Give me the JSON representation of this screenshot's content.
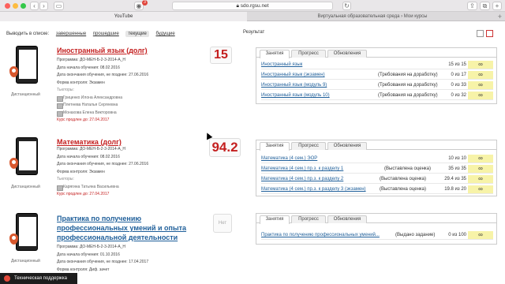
{
  "browser": {
    "url": "sdo.rgsu.net",
    "notification_count": "3",
    "tabs": [
      {
        "label": "YouTube",
        "active": true
      },
      {
        "label": "Виртуальная образовательная среда › Мои курсы",
        "active": false
      }
    ]
  },
  "filter": {
    "prefix": "Выводить в списке:",
    "options": [
      "завершенные",
      "прошедшие",
      "текущие",
      "будущие"
    ],
    "current": "текущие",
    "result_label": "Результат"
  },
  "courses": [
    {
      "title": "Иностранный язык (долг)",
      "program": "Программа: ДО-МЕН-Б-2-3-2014-А_Н",
      "start": "Дата начала обучения: 08.02.2016",
      "end": "Дата окончания обучения, не позднее: 27.06.2016",
      "control": "Форма контроля: Экзамен",
      "tutors_head": "Тьюторы:",
      "tutors": [
        "Гриценко Илона Александровна",
        "Плетнева Наталья Сергеевна",
        "Монахова Елена Викторовна"
      ],
      "extended": "Курс продлен до: 27.04.2017",
      "mode": "Дистанционный",
      "score": "15",
      "tabs": [
        "Занятия",
        "Прогресс",
        "Обновления"
      ],
      "rows": [
        {
          "name": "Иностранный язык",
          "status": "",
          "value": "15 из 15",
          "icon": "∞"
        },
        {
          "name": "Иностранный язык (экзамен)",
          "status": "(Требования на доработку)",
          "value": "0 из 17",
          "icon": "∞"
        },
        {
          "name": "Иностранный язык (модуль 9)",
          "status": "(Требования на доработку)",
          "value": "0 из 33",
          "icon": "∞"
        },
        {
          "name": "Иностранный язык (модуль 10)",
          "status": "(Требования на доработку)",
          "value": "0 из 32",
          "icon": "∞"
        }
      ]
    },
    {
      "title": "Математика (долг)",
      "program": "Программа: ДО-МЕН-Б-2-3-2014-А_Н",
      "start": "Дата начала обучения: 08.02.2016",
      "end": "Дата окончания обучения, не позднее: 27.06.2016",
      "control": "Форма контроля: Экзамен",
      "tutors_head": "Тьюторы:",
      "tutors": [
        "Карягина Татьяна Васильевна"
      ],
      "extended": "Курс продлен до: 27.04.2017",
      "mode": "Дистанционный",
      "score": "94.2",
      "tabs": [
        "Занятия",
        "Прогресс",
        "Обновления"
      ],
      "rows": [
        {
          "name": "Математика (4 сем.) ЭОР",
          "status": "",
          "value": "10 из 10",
          "icon": "∞"
        },
        {
          "name": "Математика (4 сем.) пр.з. к разделу 1",
          "status": "(Выставлена оценка)",
          "value": "35 из 35",
          "icon": "∞"
        },
        {
          "name": "Математика (4 сем.) пр.з. к разделу 2",
          "status": "(Выставлена оценка)",
          "value": "29.4 из 35",
          "icon": "∞"
        },
        {
          "name": "Математика (4 сем.) пр.з. к разделу 3 (экзамен)",
          "status": "(Выставлена оценка)",
          "value": "19.8 из 20",
          "icon": "∞"
        }
      ]
    },
    {
      "title": "Практика по получению профессиональных умений и опыта профессиональной деятельности",
      "program": "Программа: ДО-МЕН-Б-2-3-2014-А_Н",
      "start": "Дата начала обучения: 01.10.2016",
      "end": "Дата окончания обучения, не позднее: 17.04.2017",
      "control": "Форма контроля: Диф. зачет",
      "mode": "Дистанционный",
      "score": "Нет",
      "tabs": [
        "Занятия",
        "Прогресс",
        "Обновления"
      ],
      "rows": [
        {
          "name": "Практика по получению профессиональных умений...",
          "status": "(Выдано задание)",
          "value": "0 из 100",
          "icon": "∞"
        }
      ]
    }
  ],
  "support": "Техническая поддержка",
  "colors": {
    "accent_red": "#c41f1f",
    "link_blue": "#1f5f9a",
    "infinity_bg": "#f7f3a8"
  }
}
